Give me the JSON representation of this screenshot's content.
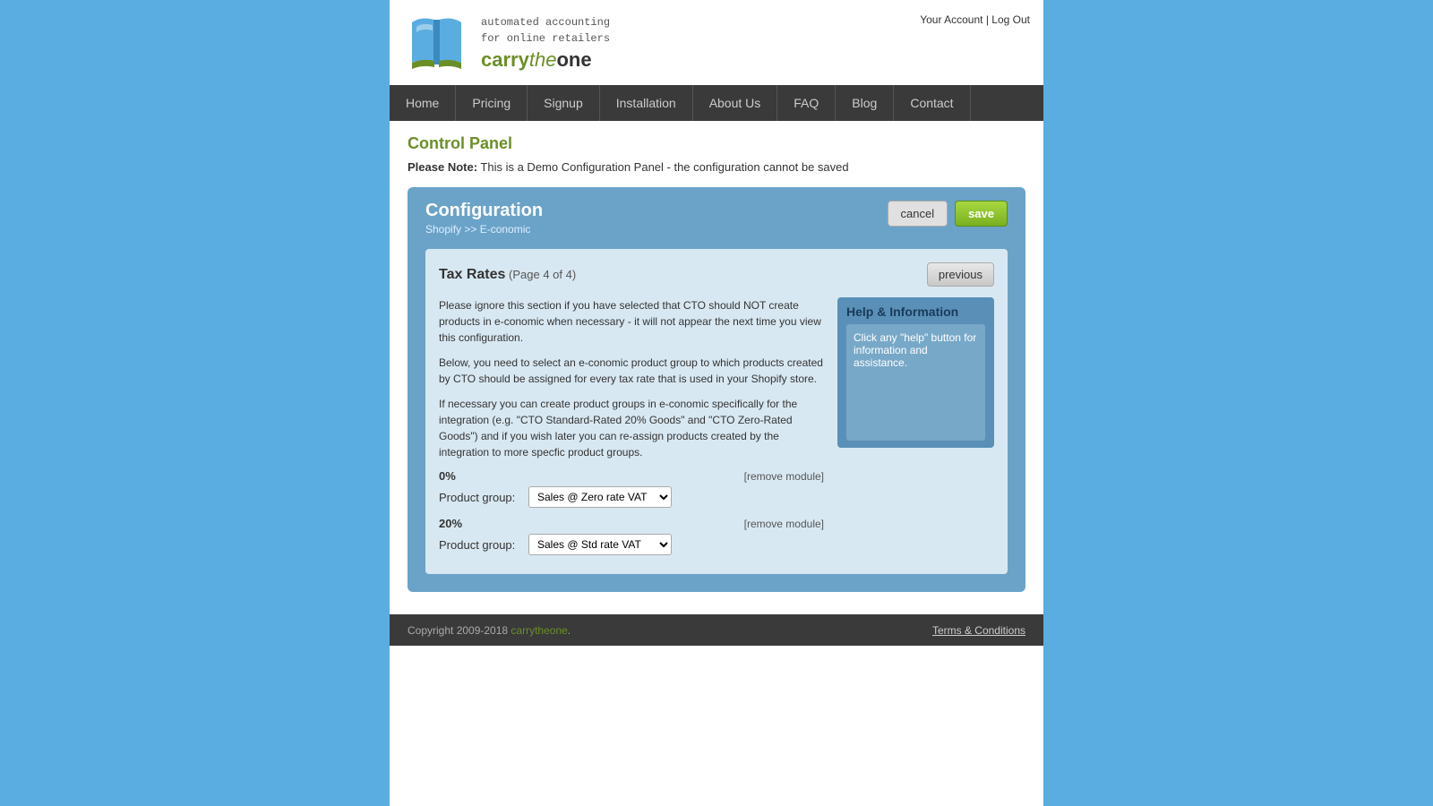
{
  "header": {
    "tagline_line1": "automated accounting",
    "tagline_line2": "for online retailers",
    "logo_carry": "carry",
    "logo_the": "the",
    "logo_one": "one",
    "account_link": "Your Account",
    "separator": "|",
    "logout_link": "Log Out"
  },
  "nav": {
    "items": [
      {
        "label": "Home",
        "id": "home"
      },
      {
        "label": "Pricing",
        "id": "pricing"
      },
      {
        "label": "Signup",
        "id": "signup"
      },
      {
        "label": "Installation",
        "id": "installation"
      },
      {
        "label": "About Us",
        "id": "about-us"
      },
      {
        "label": "FAQ",
        "id": "faq"
      },
      {
        "label": "Blog",
        "id": "blog"
      },
      {
        "label": "Contact",
        "id": "contact"
      }
    ]
  },
  "page": {
    "title": "Control Panel",
    "notice_prefix": "Please Note:",
    "notice_text": " This is a Demo Configuration Panel - the configuration cannot be saved"
  },
  "config": {
    "title": "Configuration",
    "subtitle": "Shopify >> E-conomic",
    "cancel_label": "cancel",
    "save_label": "save"
  },
  "tax_rates": {
    "title": "Tax Rates",
    "page_info": "(Page 4 of 4)",
    "previous_label": "previous",
    "para1": "Please ignore this section if you have selected that CTO should NOT create products in e-conomic when necessary - it will not appear the next time you view this configuration.",
    "para2": "Below, you need to select an e-conomic product group to which products created by CTO should be assigned for every tax rate that is used in your Shopify store.",
    "para3": "If necessary you can create product groups in e-conomic specifically for the integration (e.g. \"CTO Standard-Rated 20% Goods\" and \"CTO Zero-Rated Goods\") and if you wish later you can re-assign products created by the integration to more specfic product groups.",
    "rate1": {
      "label": "0%",
      "remove": "[remove module]",
      "product_group_label": "Product group:",
      "select_value": "Sales @ Zero rate VAT",
      "options": [
        "Sales @ Zero rate VAT",
        "Sales @ Std rate VAT"
      ]
    },
    "rate2": {
      "label": "20%",
      "remove": "[remove module]",
      "product_group_label": "Product group:",
      "select_value": "Sales @ Std rate VAT",
      "options": [
        "Sales @ Zero rate VAT",
        "Sales @ Std rate VAT"
      ]
    }
  },
  "help": {
    "title": "Help & Information",
    "text": "Click any \"help\" button for information and assistance."
  },
  "footer": {
    "copyright": "Copyright 2009-2018 ",
    "cto_link_text": "carrytheone",
    "cto_link_suffix": ".",
    "terms_label": "Terms & Conditions"
  }
}
